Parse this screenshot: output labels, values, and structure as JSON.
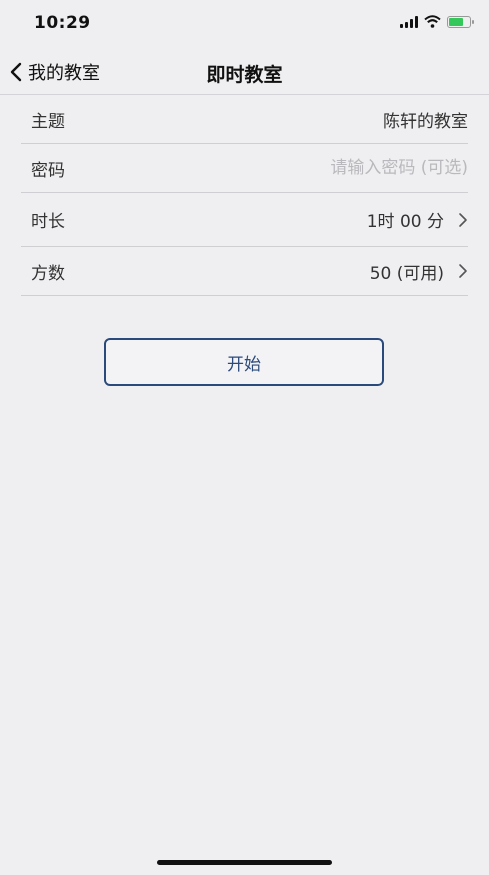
{
  "status_bar": {
    "time": "10:29"
  },
  "nav": {
    "back_label": "我的教室",
    "title": "即时教室"
  },
  "form": {
    "topic": {
      "label": "主题",
      "value": "陈轩的教室"
    },
    "password": {
      "label": "密码",
      "placeholder": "请输入密码 (可选)",
      "value": ""
    },
    "duration": {
      "label": "时长",
      "value": "1时 00 分"
    },
    "participants": {
      "label": "方数",
      "value": "50 (可用)"
    }
  },
  "actions": {
    "start_label": "开始"
  },
  "colors": {
    "accent": "#2b4a7c",
    "background": "#efeff1"
  }
}
